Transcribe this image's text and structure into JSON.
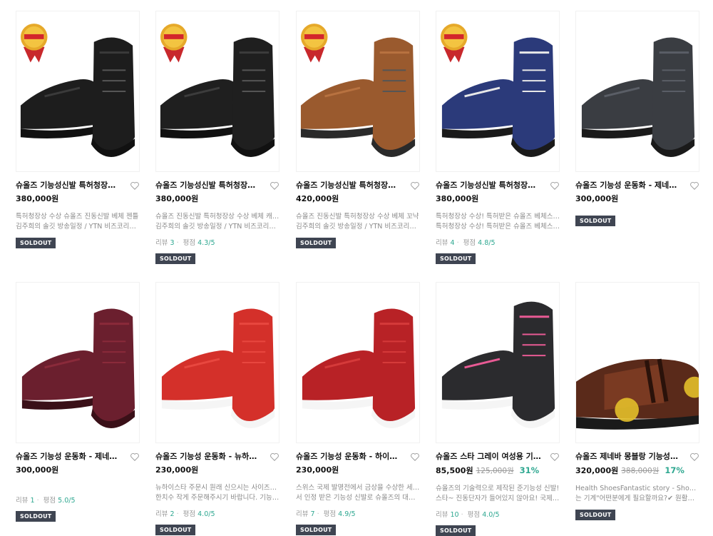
{
  "colors": {
    "discount": "#2fa891",
    "badge_bg": "#3f4552",
    "desc_text": "#8a8a8a"
  },
  "icons": {
    "wishlist": "heart-outline-icon",
    "award": "award-ribbon-icon"
  },
  "products": [
    {
      "title": "슈올즈 기능성신발 특허청장상 수...",
      "price": "380,000원",
      "orig_price": "",
      "discount": "",
      "desc1": "특허청장상 수상 슈올즈 진동신발 베체 젠틀",
      "desc2": "김주희의 솔깃 방송일정 / YTN 비즈코리아 ...",
      "review_label": "",
      "review_count": "",
      "rating_label": "",
      "rating": "",
      "badge": "SOLDOUT",
      "award": "2019 대한민국 발명특허대전 특허청장상",
      "shoe_color": "#1d1d1d",
      "shoe_accent": "#3a3a3a",
      "sole": "#111111"
    },
    {
      "title": "슈올즈 기능성신발 특허청장상 수...",
      "price": "380,000원",
      "orig_price": "",
      "discount": "",
      "desc1": "슈올즈 진동신발 특허청장상 수상 베체 캐주얼",
      "desc2": "김주희의 솔깃 방송일정 / YTN 비즈코리아 ...",
      "review_label": "리뷰",
      "review_count": "3",
      "rating_label": "평점",
      "rating": "4.3/5",
      "badge": "SOLDOUT",
      "award": "2019 대한민국 발명특허대전 특허청장상",
      "shoe_color": "#1f1f1f",
      "shoe_accent": "#3c3c3c",
      "sole": "#111111"
    },
    {
      "title": "슈올즈 기능성신발 특허청장상 수...",
      "price": "420,000원",
      "orig_price": "",
      "discount": "",
      "desc1": "슈올즈 진동신발 특허청장상 수상 베체 꼬냑",
      "desc2": "김주희의 솔깃 방송일정 / YTN 비즈코리아 ...",
      "review_label": "",
      "review_count": "",
      "rating_label": "",
      "rating": "",
      "badge": "SOLDOUT",
      "award": "2019 대한민국 발명특허대전 특허청장상",
      "shoe_color": "#9a5a2e",
      "shoe_accent": "#b87240",
      "sole": "#2a2a2a"
    },
    {
      "title": "슈올즈 기능성신발 특허청장상 수...",
      "price": "380,000원",
      "orig_price": "",
      "discount": "",
      "desc1": "특허청장상 수상! 특허받은 슈올즈 베체스포츠",
      "desc2": "특허청장상 수상! 특허받은 슈올즈 베체스포츠...",
      "review_label": "리뷰",
      "review_count": "4",
      "rating_label": "평점",
      "rating": "4.8/5",
      "badge": "SOLDOUT",
      "award": "2019 대한민국 발명특허대전 특허청장상",
      "shoe_color": "#2b3a7a",
      "shoe_accent": "#e8e8e8",
      "sole": "#1a1a1a"
    },
    {
      "title": "슈올즈 기능성 운동화 - 제네바스포...",
      "price": "300,000원",
      "orig_price": "",
      "discount": "",
      "desc1": "",
      "desc2": "",
      "review_label": "",
      "review_count": "",
      "rating_label": "",
      "rating": "",
      "badge": "SOLDOUT",
      "award": "",
      "shoe_color": "#3a3d42",
      "shoe_accent": "#5a5e66",
      "sole": "#1a1a1a"
    },
    {
      "title": "슈올즈 기능성 운동화 - 제네바스포...",
      "price": "300,000원",
      "orig_price": "",
      "discount": "",
      "desc1": "",
      "desc2": "",
      "review_label": "리뷰",
      "review_count": "1",
      "rating_label": "평점",
      "rating": "5.0/5",
      "badge": "SOLDOUT",
      "award": "",
      "shoe_color": "#6b1f2e",
      "shoe_accent": "#8a2a3a",
      "sole": "#3a1018"
    },
    {
      "title": "슈올즈 기능성 운동화 - 뉴하이스타...",
      "price": "230,000원",
      "orig_price": "",
      "discount": "",
      "desc1": "뉴하이스타 주문시 원래 신으시는 사이즈보다",
      "desc2": "한치수 작게 주문해주시기 바랍니다. 기능성...",
      "review_label": "리뷰",
      "review_count": "2",
      "rating_label": "평점",
      "rating": "4.0/5",
      "badge": "SOLDOUT",
      "award": "",
      "shoe_color": "#d4302a",
      "shoe_accent": "#e8473f",
      "sole": "#f5f5f5"
    },
    {
      "title": "슈올즈 기능성 운동화 - 하이스타 ...",
      "price": "230,000원",
      "orig_price": "",
      "discount": "",
      "desc1": "스위스 국제 발명전에서 금상을 수상한 세계에",
      "desc2": "서 인정 받은 기능성 신발로 슈올즈의 대표 ...",
      "review_label": "리뷰",
      "review_count": "7",
      "rating_label": "평점",
      "rating": "4.9/5",
      "badge": "SOLDOUT",
      "award": "",
      "shoe_color": "#b82226",
      "shoe_accent": "#d53a3a",
      "sole": "#f5f5f5"
    },
    {
      "title": "슈올즈 스타 그레이 여성용 기능성...",
      "price": "85,500원",
      "orig_price": "125,000원",
      "discount": "31%",
      "desc1": "슈올즈의 기술력으로 제작된 준기능성 신발!",
      "desc2": "스타~ 진동단자가 들어있지 않아요! 국제발...",
      "review_label": "리뷰",
      "review_count": "10",
      "rating_label": "평점",
      "rating": "4.0/5",
      "badge": "SOLDOUT",
      "award": "",
      "shoe_color": "#2b2b2e",
      "shoe_accent": "#e85a94",
      "sole": "#f5f5f5"
    },
    {
      "title": "슈올즈 제네바 몽블랑 기능성신발 ...",
      "price": "320,000원",
      "orig_price": "388,000원",
      "discount": "17%",
      "desc1": "Health ShoesFantastic story - Shoe tech\"신",
      "desc2": "는 기계\"어떤분에게 필요할까요?✔ 원활한 ...",
      "review_label": "",
      "review_count": "",
      "rating_label": "",
      "rating": "",
      "badge": "SOLDOUT",
      "award": "",
      "shoe_color": "#5a2a1a",
      "shoe_accent": "#7a3a22",
      "sole": "#1a1a1a"
    }
  ]
}
